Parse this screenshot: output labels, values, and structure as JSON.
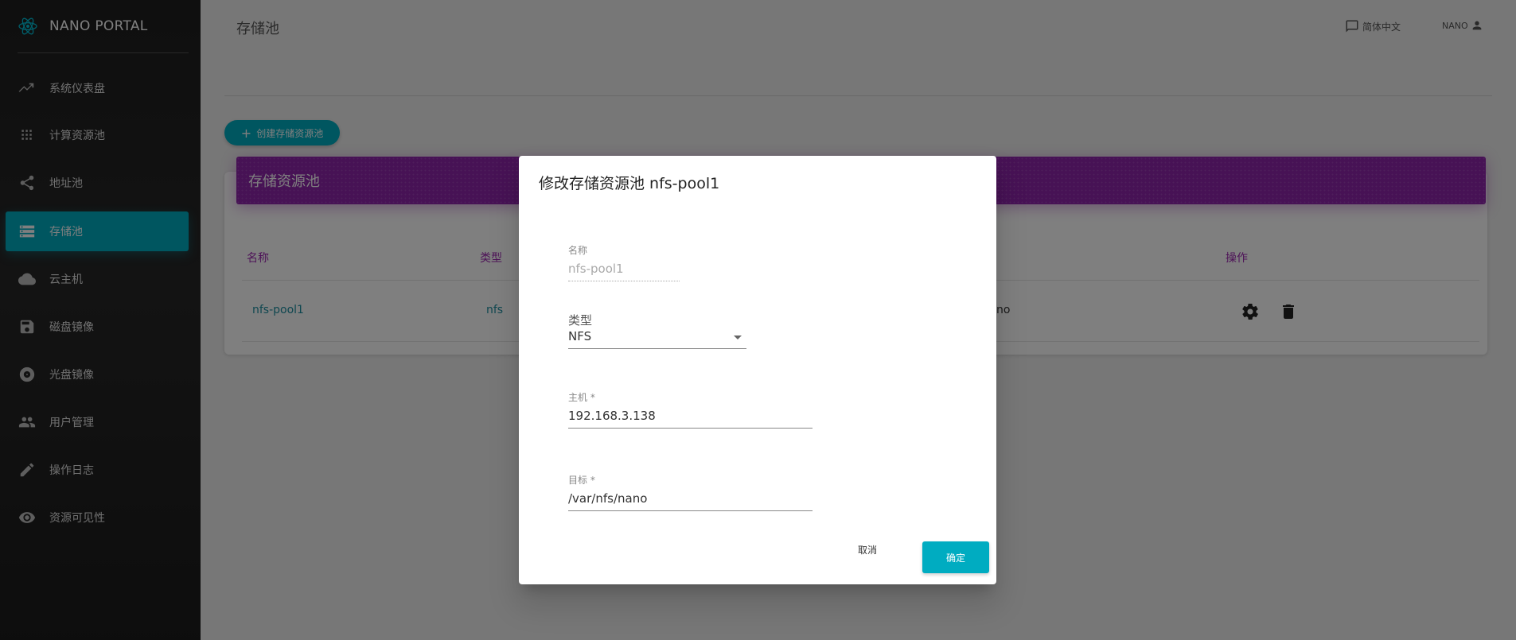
{
  "app": {
    "brand": "NANO PORTAL"
  },
  "sidebar": {
    "items": [
      {
        "label": "系统仪表盘",
        "icon": "trending-icon"
      },
      {
        "label": "计算资源池",
        "icon": "grid-icon"
      },
      {
        "label": "地址池",
        "icon": "share-icon"
      },
      {
        "label": "存储池",
        "icon": "storage-icon",
        "active": true
      },
      {
        "label": "云主机",
        "icon": "cloud-icon"
      },
      {
        "label": "磁盘镜像",
        "icon": "save-icon"
      },
      {
        "label": "光盘镜像",
        "icon": "disc-icon"
      },
      {
        "label": "用户管理",
        "icon": "people-icon"
      },
      {
        "label": "操作日志",
        "icon": "edit-icon"
      },
      {
        "label": "资源可见性",
        "icon": "eye-icon"
      }
    ]
  },
  "header": {
    "title": "存储池",
    "language": "简体中文",
    "user": "NANO"
  },
  "toolbar": {
    "create_label": "创建存储资源池"
  },
  "card": {
    "title": "存储资源池",
    "columns": [
      "名称",
      "类型",
      "操作"
    ],
    "rows": [
      {
        "name": "nfs-pool1",
        "type": "nfs",
        "target_partial": "no"
      }
    ]
  },
  "dialog": {
    "title": "修改存储资源池 nfs-pool1",
    "name_label": "名称",
    "name_value": "nfs-pool1",
    "type_label": "类型",
    "type_value": "NFS",
    "host_label": "主机 *",
    "host_value": "192.168.3.138",
    "target_label": "目标 *",
    "target_value": "/var/nfs/nano",
    "cancel_label": "取消",
    "ok_label": "确定"
  },
  "colors": {
    "accent": "#00acc1",
    "header_purple": "#8e24aa",
    "sidebar_bg": "#262626"
  }
}
